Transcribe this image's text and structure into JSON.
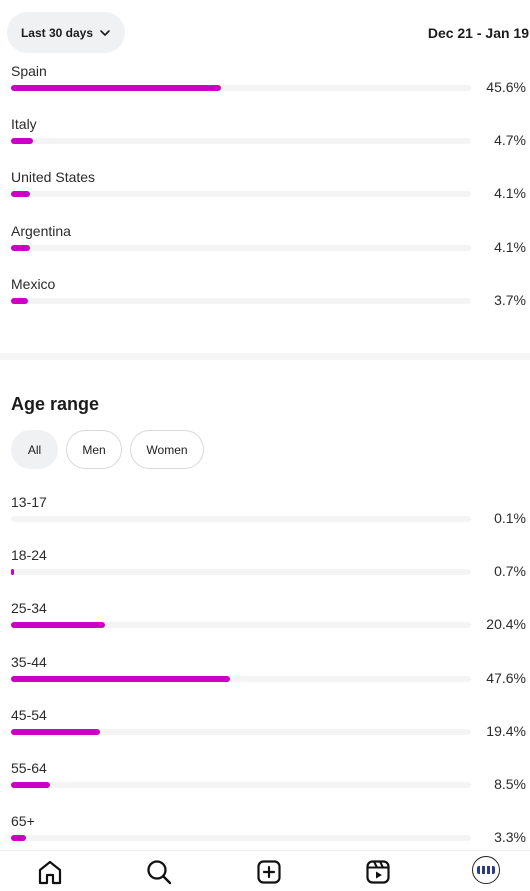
{
  "header": {
    "range_label": "Last 30 days",
    "date_range": "Dec 21 - Jan 19"
  },
  "countries": [
    {
      "label": "Spain",
      "percent": "45.6%",
      "value": 45.6
    },
    {
      "label": "Italy",
      "percent": "4.7%",
      "value": 4.7
    },
    {
      "label": "United States",
      "percent": "4.1%",
      "value": 4.1
    },
    {
      "label": "Argentina",
      "percent": "4.1%",
      "value": 4.1
    },
    {
      "label": "Mexico",
      "percent": "3.7%",
      "value": 3.7
    }
  ],
  "age_section": {
    "title": "Age range",
    "filters": [
      "All",
      "Men",
      "Women"
    ],
    "selected_filter": "All"
  },
  "ages": [
    {
      "label": "13-17",
      "percent": "0.1%",
      "value": 0.1
    },
    {
      "label": "18-24",
      "percent": "0.7%",
      "value": 0.7
    },
    {
      "label": "25-34",
      "percent": "20.4%",
      "value": 20.4
    },
    {
      "label": "35-44",
      "percent": "47.6%",
      "value": 47.6
    },
    {
      "label": "45-54",
      "percent": "19.4%",
      "value": 19.4
    },
    {
      "label": "55-64",
      "percent": "8.5%",
      "value": 8.5
    },
    {
      "label": "65+",
      "percent": "3.3%",
      "value": 3.3
    }
  ],
  "nav": [
    "home-icon",
    "search-icon",
    "create-icon",
    "reels-icon",
    "profile-avatar"
  ],
  "colors": {
    "bar_fill": "#cc00c5",
    "bar_track": "#f4f4f5",
    "chip_active": "#eff1f3"
  }
}
